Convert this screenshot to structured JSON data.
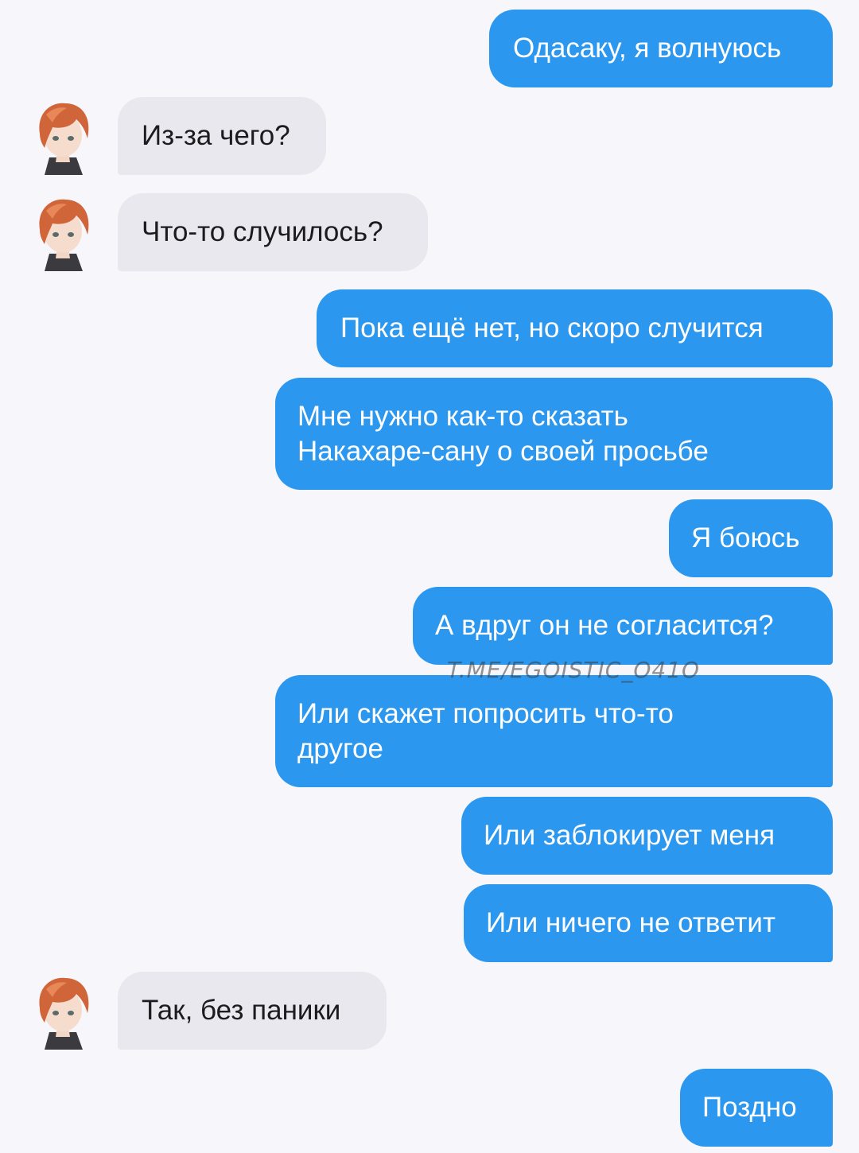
{
  "messages": [
    {
      "side": "out",
      "text": "Одасаку, я волнуюсь"
    },
    {
      "side": "in",
      "text": "Из-за чего?"
    },
    {
      "side": "in",
      "text": "Что-то случилось?"
    },
    {
      "side": "out",
      "text": "Пока ещё нет, но скоро случится"
    },
    {
      "side": "out",
      "line1": "Мне нужно как-то сказать",
      "line2": "Накахаре-сану о своей просьбе"
    },
    {
      "side": "out",
      "text": "Я боюсь"
    },
    {
      "side": "out",
      "text": "А вдруг он не согласится?"
    },
    {
      "side": "out",
      "line1": "Или скажет попросить что-то",
      "line2": "другое"
    },
    {
      "side": "out",
      "text": "Или заблокирует меня"
    },
    {
      "side": "out",
      "text": "Или ничего не ответит"
    },
    {
      "side": "in",
      "text": "Так, без паники"
    },
    {
      "side": "out",
      "text": "Поздно"
    }
  ],
  "watermark": "T.ME/EGOISTIC_O41O",
  "colors": {
    "background": "#f7f6fb",
    "outgoing_bubble": "#2b97ef",
    "incoming_bubble": "#e9e8ef",
    "avatar_hair": "#d0653a"
  },
  "contact": {
    "avatar_icon": "anime-character-avatar-icon"
  }
}
